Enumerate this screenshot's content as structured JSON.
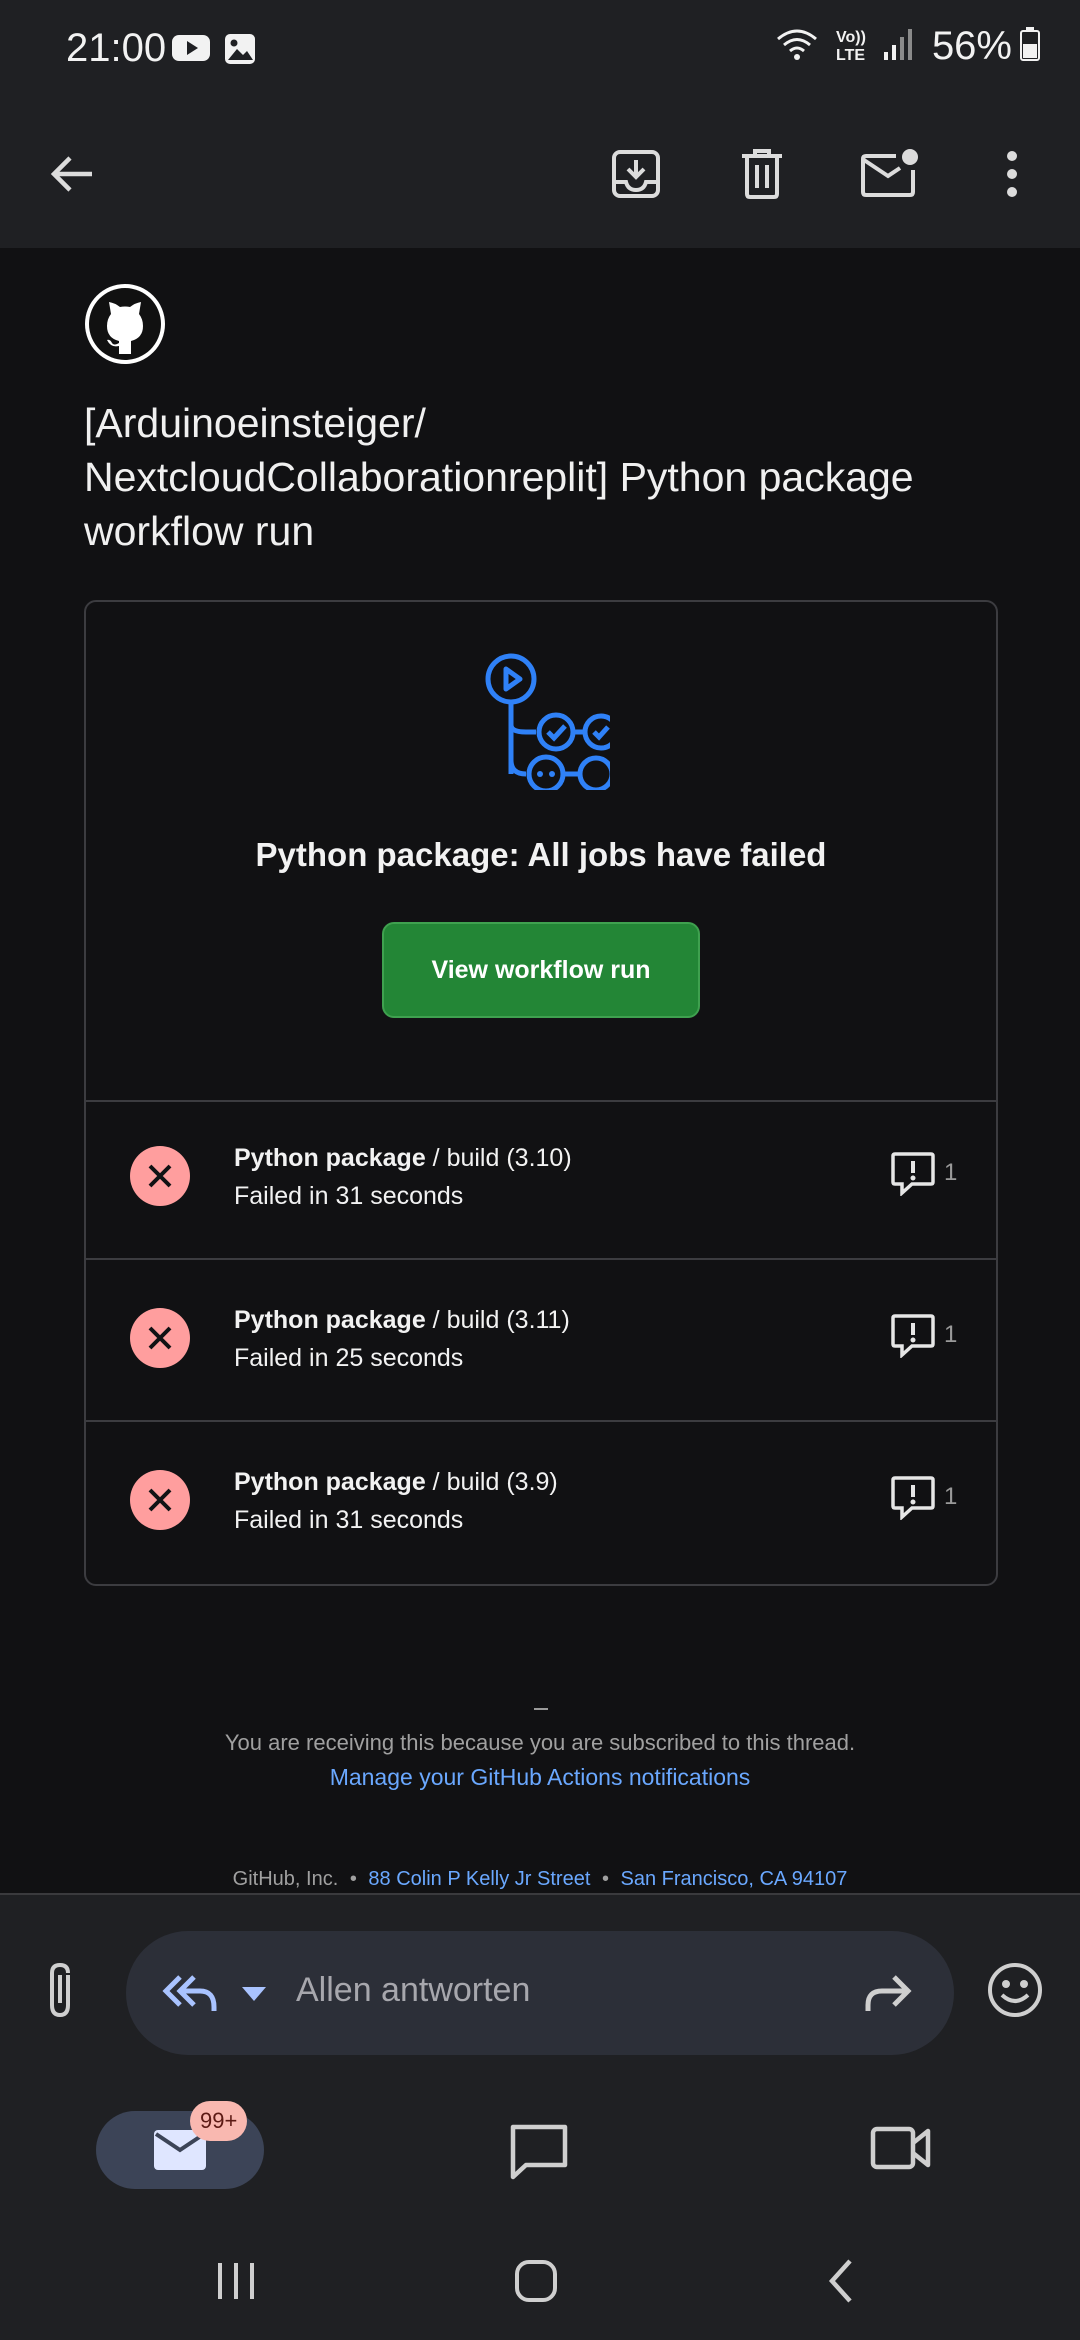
{
  "status_bar": {
    "time": "21:00",
    "battery_text": "56%",
    "icons": [
      "youtube-icon",
      "gallery-icon",
      "wifi-icon",
      "volte-icon",
      "signal-icon",
      "battery-icon"
    ],
    "volte_top": "Vo))",
    "volte_bottom": "LTE"
  },
  "toolbar": {
    "icons": [
      "back-arrow-icon",
      "archive-icon",
      "delete-icon",
      "mark-unread-icon",
      "more-vert-icon"
    ]
  },
  "email": {
    "subject_line1": "[Arduinoeinsteiger/",
    "subject_line2": "NextcloudCollaborationreplit] Python package",
    "subject_line3": "workflow run",
    "card": {
      "title": "Python package: All jobs have failed",
      "button_label": "View workflow run",
      "jobs": [
        {
          "name": "Python package",
          "suffix": " / build (3.10)",
          "status": "Failed in 31 seconds",
          "comments": "1"
        },
        {
          "name": "Python package",
          "suffix": " / build (3.11)",
          "status": "Failed in 25 seconds",
          "comments": "1"
        },
        {
          "name": "Python package",
          "suffix": " / build (3.9)",
          "status": "Failed in 31 seconds",
          "comments": "1"
        }
      ]
    },
    "footer_note": "You are receiving this because you are subscribed to this thread.",
    "footer_link": "Manage your GitHub Actions notifications",
    "address_company": "GitHub, Inc.",
    "address_street": "88 Colin P Kelly Jr Street",
    "address_city": "San Francisco, CA 94107"
  },
  "reply": {
    "placeholder": "Allen antworten"
  },
  "bottom_nav": {
    "mail_badge": "99+"
  },
  "colors": {
    "accent_green": "#238636",
    "link_blue": "#6aa8ff",
    "fail_red": "#ff9e9e",
    "workflow_blue": "#2f81f7"
  }
}
